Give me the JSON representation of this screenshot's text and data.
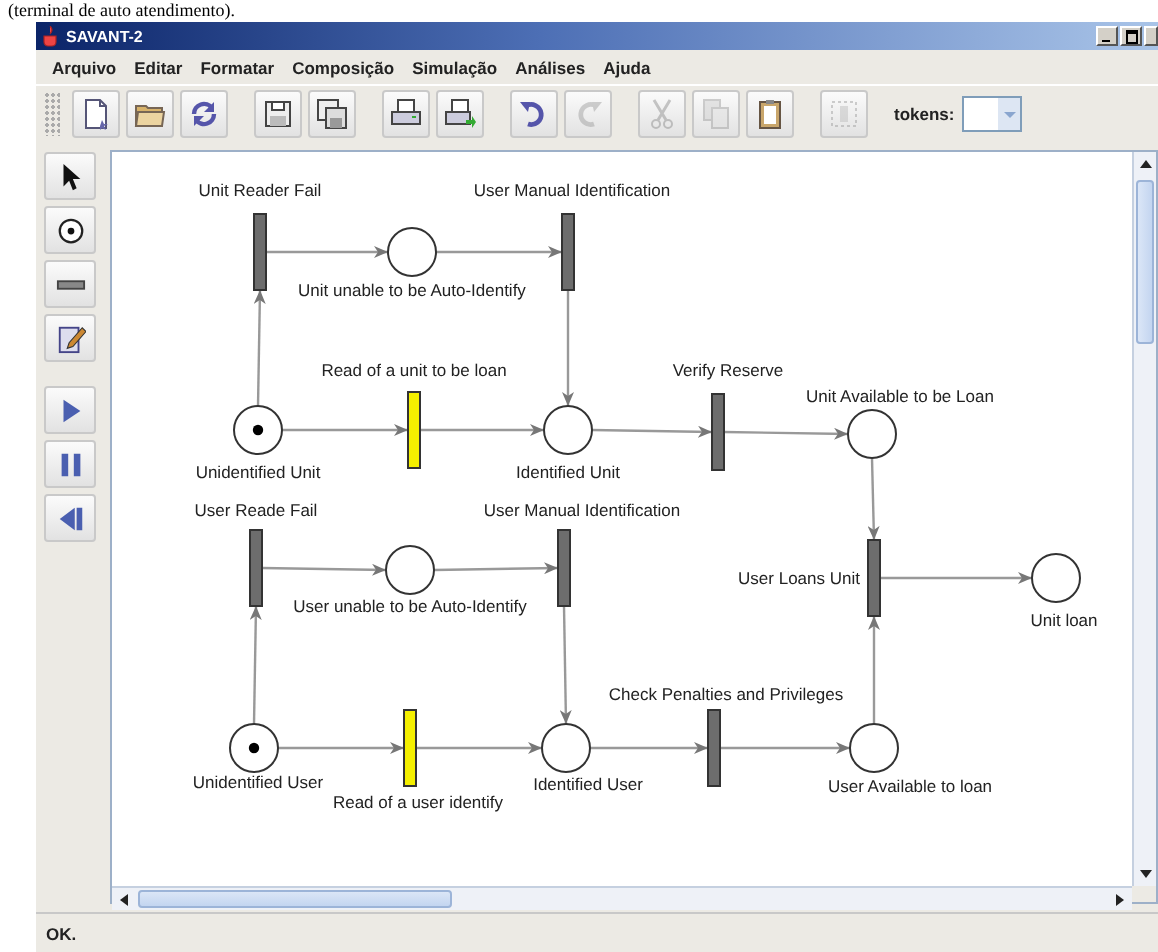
{
  "document_caption": "(terminal de auto atendimento).",
  "window": {
    "title": "SAVANT-2"
  },
  "menu": [
    "Arquivo",
    "Editar",
    "Formatar",
    "Composição",
    "Simulação",
    "Análises",
    "Ajuda"
  ],
  "toolbar": [
    {
      "kind": "new",
      "disabled": false
    },
    {
      "kind": "open",
      "disabled": false
    },
    {
      "kind": "refresh",
      "disabled": false
    },
    {
      "kind": "save",
      "disabled": false
    },
    {
      "kind": "save-all",
      "disabled": false
    },
    {
      "kind": "print",
      "disabled": false
    },
    {
      "kind": "print-preview",
      "disabled": false
    },
    {
      "kind": "undo",
      "disabled": false
    },
    {
      "kind": "redo",
      "disabled": true
    },
    {
      "kind": "cut",
      "disabled": true
    },
    {
      "kind": "copy",
      "disabled": true
    },
    {
      "kind": "paste",
      "disabled": false
    },
    {
      "kind": "delete",
      "disabled": true
    }
  ],
  "tokens_label": "tokens:",
  "palette": [
    {
      "kind": "select"
    },
    {
      "kind": "place"
    },
    {
      "kind": "transition"
    },
    {
      "kind": "edit"
    },
    {
      "kind": "play"
    },
    {
      "kind": "pause"
    },
    {
      "kind": "step-back"
    }
  ],
  "places": [
    {
      "label": "Unit unable to be Auto-Identify",
      "marked": false
    },
    {
      "label": "Unidentified Unit",
      "marked": true
    },
    {
      "label": "Identified Unit",
      "marked": false
    },
    {
      "label": "Unit Available to be Loan",
      "marked": false
    },
    {
      "label": "User unable to be Auto-Identify",
      "marked": false
    },
    {
      "label": "Unit loan",
      "marked": false
    },
    {
      "label": "Unidentified User",
      "marked": true
    },
    {
      "label": "Identified User",
      "marked": false
    },
    {
      "label": "User Available to loan",
      "marked": false
    }
  ],
  "transitions": [
    {
      "label": "Unit Reader Fail",
      "enabled": false
    },
    {
      "label": "User Manual Identification",
      "enabled": false
    },
    {
      "label": "Read of a unit to be loan",
      "enabled": true
    },
    {
      "label": "Verify Reserve",
      "enabled": false
    },
    {
      "label": "User Reade Fail",
      "enabled": false
    },
    {
      "label": "User Manual Identification",
      "enabled": false
    },
    {
      "label": "User Loans Unit",
      "enabled": false
    },
    {
      "label": "Read of a user identify",
      "enabled": true
    },
    {
      "label": "Check Penalties and Privileges",
      "enabled": false
    }
  ],
  "status_bar": "OK."
}
